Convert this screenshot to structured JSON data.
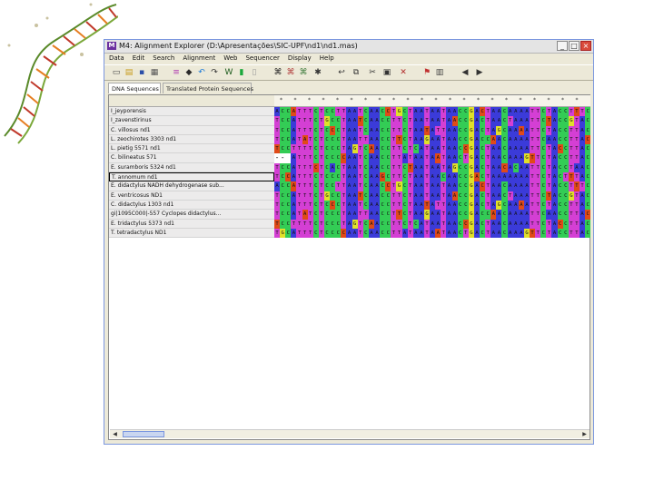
{
  "window": {
    "title": "M4: Alignment Explorer (D:\\Apresentações\\SIC-UPF\\nd1\\nd1.mas)",
    "icon_label": "M",
    "controls": {
      "minimize": "_",
      "maximize": "□",
      "close": "×"
    }
  },
  "menu": [
    "Data",
    "Edit",
    "Search",
    "Alignment",
    "Web",
    "Sequencer",
    "Display",
    "Help"
  ],
  "toolbar_icons": [
    "new-icon",
    "open-icon",
    "save-icon",
    "print-icon",
    "align-icon",
    "muscle-icon",
    "undo-icon",
    "redo-icon",
    "w-align-icon",
    "translate-icon",
    "mark-icon",
    "binoculars-icon",
    "binoculars-next-icon",
    "binoculars-prev-icon",
    "find-icon",
    "insert-icon",
    "copy-icon",
    "cut-icon",
    "paste-icon",
    "delete-icon",
    "flag-icon",
    "ruler-icon",
    "prev-icon",
    "next-icon"
  ],
  "tabs": [
    "DNA Sequences",
    "Translated Protein Sequences"
  ],
  "sequences": [
    {
      "name": "I_jeyporensis",
      "pattern": "A"
    },
    {
      "name": "I_zavenstirinus",
      "pattern": "B"
    },
    {
      "name": "C. villosus nd1",
      "pattern": "C"
    },
    {
      "name": "L. zeochirotes 3303 nd1",
      "pattern": "D"
    },
    {
      "name": "L. pietig 5571 nd1",
      "pattern": "E"
    },
    {
      "name": "C. bilineatus 571",
      "pattern": "F"
    },
    {
      "name": "E. suramboris 5324 nd1",
      "pattern": "G"
    },
    {
      "name": "T. annomum nd1",
      "pattern": "H"
    },
    {
      "name": "E. didactylus NADH dehydrogenase sub...",
      "pattern": "A"
    },
    {
      "name": "E. ventricosus ND1",
      "pattern": "B"
    },
    {
      "name": "C. didactylus 1303 nd1",
      "pattern": "C"
    },
    {
      "name": "gi|1095C000|-557 Cyclopes didactylus...",
      "pattern": "D"
    },
    {
      "name": "E. tridactylus 5373 nd1",
      "pattern": "E"
    },
    {
      "name": "T. tetradactylus ND1",
      "pattern": "F"
    }
  ],
  "gap_text": "---",
  "bases": "TCCATTTCTCCCTAATCAACCTTCTAATAATAACCGACTAACAAAATTCTACCTTAC",
  "base_colors": {
    "A": "#3b3bd9",
    "C": "#33cc55",
    "G": "#e0e02a",
    "T": "#d43fd4",
    "X": "#e04a18"
  },
  "column_markers": "*"
}
